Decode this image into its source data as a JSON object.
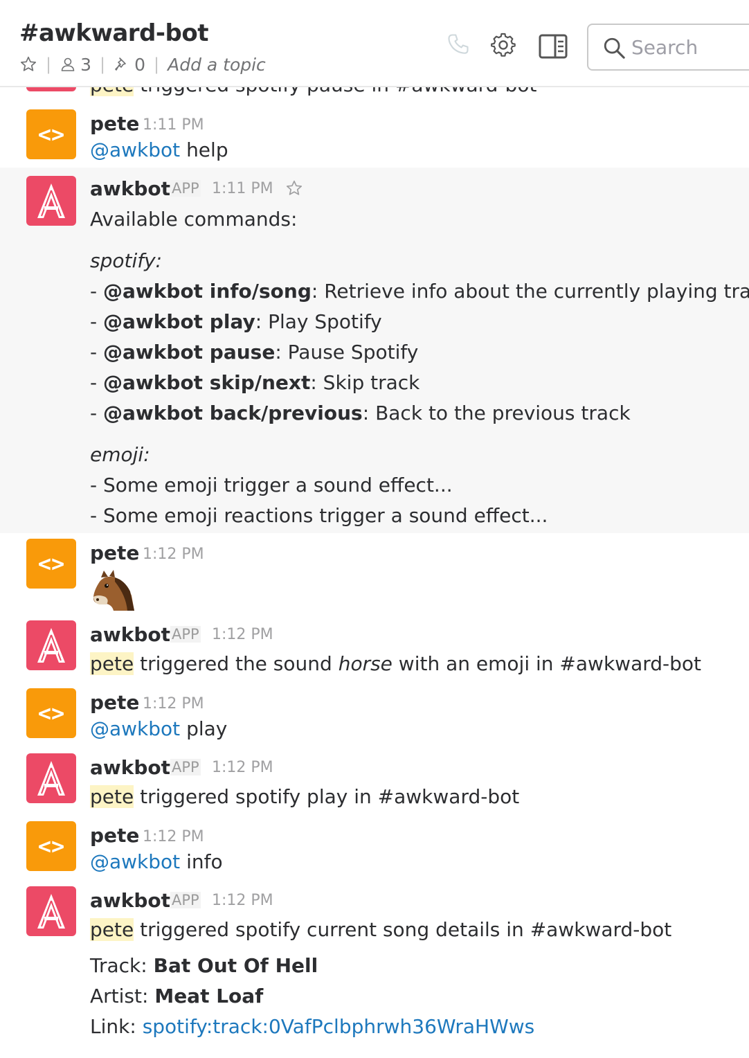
{
  "header": {
    "channel": "#awkward-bot",
    "members_count": "3",
    "pins_count": "0",
    "topic_placeholder": "Add a topic",
    "search_placeholder": "Search"
  },
  "partial_top": {
    "name": "pete",
    "text": "triggered spotify pause in #awkward-bot"
  },
  "messages": [
    {
      "author": "pete",
      "time": "1:11 PM",
      "mention": "@awkbot",
      "text": "help"
    },
    {
      "author": "awkbot",
      "app": "APP",
      "time": "1:11 PM",
      "intro": "Available commands:",
      "spotify_heading": "spotify:",
      "dash": "- ",
      "commands": [
        {
          "cmd": "@awkbot info/song",
          "desc": ": Retrieve info about the currently playing track"
        },
        {
          "cmd": "@awkbot play",
          "desc": ": Play Spotify"
        },
        {
          "cmd": "@awkbot pause",
          "desc": ": Pause Spotify"
        },
        {
          "cmd": "@awkbot skip/next",
          "desc": ": Skip track"
        },
        {
          "cmd": "@awkbot back/previous",
          "desc": ": Back to the previous track"
        }
      ],
      "emoji_heading": "emoji:",
      "emoji_lines": [
        "- Some emoji trigger a sound effect...",
        "- Some emoji reactions trigger a sound effect..."
      ]
    },
    {
      "author": "pete",
      "time": "1:12 PM",
      "emoji": "horse-face"
    },
    {
      "author": "awkbot",
      "app": "APP",
      "time": "1:12 PM",
      "who": "pete",
      "pre": " triggered the sound ",
      "sound": "horse",
      "post": " with an emoji in #awkward-bot"
    },
    {
      "author": "pete",
      "time": "1:12 PM",
      "mention": "@awkbot",
      "text": "play"
    },
    {
      "author": "awkbot",
      "app": "APP",
      "time": "1:12 PM",
      "who": "pete",
      "text": " triggered spotify play in #awkward-bot"
    },
    {
      "author": "pete",
      "time": "1:12 PM",
      "mention": "@awkbot",
      "text": "info"
    },
    {
      "author": "awkbot",
      "app": "APP",
      "time": "1:12 PM",
      "who": "pete",
      "text": " triggered spotify current song details in #awkward-bot",
      "track_label": "Track: ",
      "track": "Bat Out Of Hell",
      "artist_label": "Artist: ",
      "artist": "Meat Loaf",
      "link_label": "Link: ",
      "link": "spotify:track:0VafPclbphrwh36WraHWws"
    }
  ],
  "colors": {
    "pete_avatar": "#f99a0a",
    "awkbot_avatar": "#ec4a66",
    "mention": "#1d78bd",
    "highlight": "#fdf4c5"
  }
}
